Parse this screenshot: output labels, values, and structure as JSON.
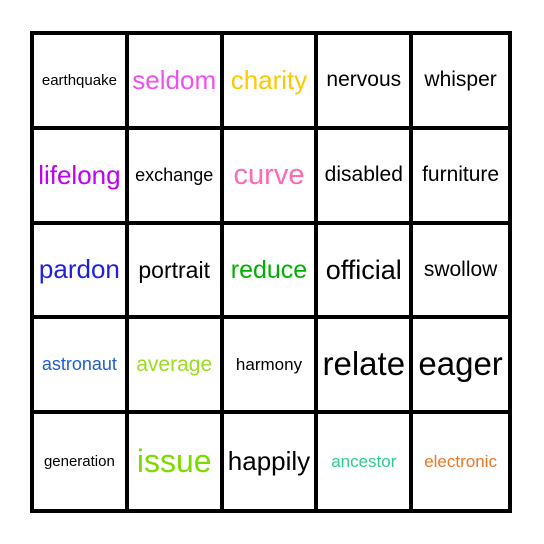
{
  "card": {
    "type": "bingo-card",
    "rows": 5,
    "columns": 5,
    "border_color": "#000000",
    "background_color": "#ffffff",
    "cells": [
      [
        {
          "word": "earthquake",
          "color": "#000000",
          "font_size": 15
        },
        {
          "word": "seldom",
          "color": "#ee52ee",
          "font_size": 26
        },
        {
          "word": "charity",
          "color": "#ffc800",
          "font_size": 26
        },
        {
          "word": "nervous",
          "color": "#000000",
          "font_size": 21
        },
        {
          "word": "whisper",
          "color": "#000000",
          "font_size": 21
        }
      ],
      [
        {
          "word": "lifelong",
          "color": "#c000f0",
          "font_size": 26
        },
        {
          "word": "exchange",
          "color": "#000000",
          "font_size": 18
        },
        {
          "word": "curve",
          "color": "#ff69b4",
          "font_size": 29
        },
        {
          "word": "disabled",
          "color": "#000000",
          "font_size": 21
        },
        {
          "word": "furniture",
          "color": "#000000",
          "font_size": 21
        }
      ],
      [
        {
          "word": "pardon",
          "color": "#2020e0",
          "font_size": 26
        },
        {
          "word": "portrait",
          "color": "#000000",
          "font_size": 23
        },
        {
          "word": "reduce",
          "color": "#00b000",
          "font_size": 25
        },
        {
          "word": "official",
          "color": "#000000",
          "font_size": 27
        },
        {
          "word": "swollow",
          "color": "#000000",
          "font_size": 21
        }
      ],
      [
        {
          "word": "astronaut",
          "color": "#1f5fd0",
          "font_size": 18
        },
        {
          "word": "average",
          "color": "#9adc20",
          "font_size": 21
        },
        {
          "word": "harmony",
          "color": "#000000",
          "font_size": 17
        },
        {
          "word": "relate",
          "color": "#000000",
          "font_size": 33
        },
        {
          "word": "eager",
          "color": "#000000",
          "font_size": 33
        }
      ],
      [
        {
          "word": "generation",
          "color": "#000000",
          "font_size": 15
        },
        {
          "word": "issue",
          "color": "#7cdc00",
          "font_size": 32
        },
        {
          "word": "happily",
          "color": "#000000",
          "font_size": 26
        },
        {
          "word": "ancestor",
          "color": "#2ecc8f",
          "font_size": 17
        },
        {
          "word": "electronic",
          "color": "#ee7722",
          "font_size": 17
        }
      ]
    ]
  }
}
